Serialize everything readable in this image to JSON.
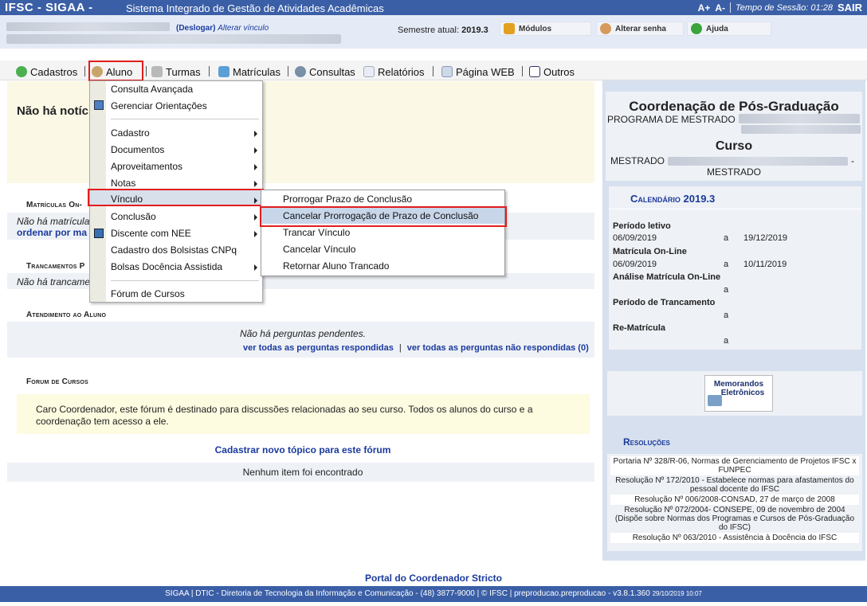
{
  "header": {
    "brand": "IFSC - SIGAA -",
    "subtitle": "Sistema Integrado de Gestão de Atividades Acadêmicas",
    "font_up": "A+",
    "font_down": "A-",
    "session_label": "Tempo de Sessão: 01:28",
    "exit_label": "SAIR"
  },
  "infobar": {
    "logout": "(Deslogar)",
    "change_link": "Alterar vínculo",
    "semester_label": "Semestre atual:",
    "semester_value": "2019.3",
    "btn_modules": "Módulos",
    "btn_password": "Alterar senha",
    "btn_help": "Ajuda"
  },
  "menu": {
    "cadastros": "Cadastros",
    "aluno": "Aluno",
    "turmas": "Turmas",
    "matriculas": "Matrículas",
    "consultas": "Consultas",
    "relatorios": "Relatórios",
    "pagina_web": "Página WEB",
    "outros": "Outros"
  },
  "dropdown": {
    "items": [
      "Consulta Avançada",
      "Gerenciar Orientações",
      "Cadastro",
      "Documentos",
      "Aproveitamentos",
      "Notas",
      "Vínculo",
      "Conclusão",
      "Discente com NEE",
      "Cadastro dos Bolsistas CNPq",
      "Bolsas Docência Assistida",
      "Fórum de Cursos"
    ]
  },
  "submenu": {
    "items": [
      "Prorrogar Prazo de Conclusão",
      "Cancelar Prorrogação de Prazo de Conclusão",
      "Trancar Vínculo",
      "Cancelar Vínculo",
      "Retornar Aluno Trancado"
    ]
  },
  "left": {
    "news": "Não há notíci",
    "matriculas_head": "Matrículas On-",
    "matriculas_text": "Não há matrícula",
    "matriculas_link": "ordenar por ma",
    "trancamentos_head": "Trancamentos P",
    "trancamentos_text": "Não há trancame",
    "atendimento_head": "Atendimento ao Aluno",
    "atendimento_text": "Não há perguntas pendentes.",
    "link_answered": "ver todas as perguntas respondidas",
    "link_pipe": "|",
    "link_unanswered": "ver todas as perguntas não respondidas (0)",
    "forum_head": "Forum de Cursos",
    "forum_text": "Caro Coordenador, este fórum é destinado para discussões relacionadas ao seu curso. Todos os alunos do curso e a coordenação tem acesso a ele.",
    "forum_new": "Cadastrar novo tópico para este fórum",
    "forum_empty": "Nenhum item foi encontrado"
  },
  "right": {
    "coord_title": "Coordenação de Pós-Graduação",
    "program_prefix": "PROGRAMA DE MESTRADO",
    "course_title": "Curso",
    "course_prefix": "MESTRADO",
    "course_dash": "-",
    "course_suffix": "MESTRADO",
    "calendar_label": "Calendário",
    "calendar_year": "2019.3",
    "calendar": [
      {
        "label": "Período letivo",
        "start": "06/09/2019",
        "a": "a",
        "end": "19/12/2019"
      },
      {
        "label": "Matrícula On-Line",
        "start": "06/09/2019",
        "a": "a",
        "end": "10/11/2019"
      },
      {
        "label": "Análise Matrícula On-Line",
        "start": "",
        "a": "a",
        "end": ""
      },
      {
        "label": "Período de Trancamento",
        "start": "",
        "a": "a",
        "end": ""
      },
      {
        "label": "Re-Matrícula",
        "start": "",
        "a": "a",
        "end": ""
      }
    ],
    "memo_line1": "Memorandos",
    "memo_line2": "Eletrônicos",
    "resolucoes_head": "Resoluções",
    "resolucoes": [
      "Portaria Nº 328/R-06, Normas de Gerenciamento de Projetos IFSC x FUNPEC",
      "Resolução Nº 172/2010 - Estabelece normas para afastamentos do pessoal docente do IFSC",
      "Resolução Nº 006/2008-CONSAD, 27 de março de 2008",
      "Resolução Nº 072/2004- CONSEPE, 09 de novembro de 2004 (Dispõe sobre Normas dos Programas e Cursos de Pós-Graduação do IFSC)",
      "Resolução Nº 063/2010 - Assistência à Docência do IFSC"
    ]
  },
  "footer": {
    "portal": "Portal do Coordenador Stricto",
    "text": "SIGAA | DTIC - Diretoria de Tecnologia da Informação e Comunicação - (48) 3877-9000 | © IFSC | preproducao.preproducao - v3.8.1.360",
    "stamp": "29/10/2019 10:07"
  }
}
